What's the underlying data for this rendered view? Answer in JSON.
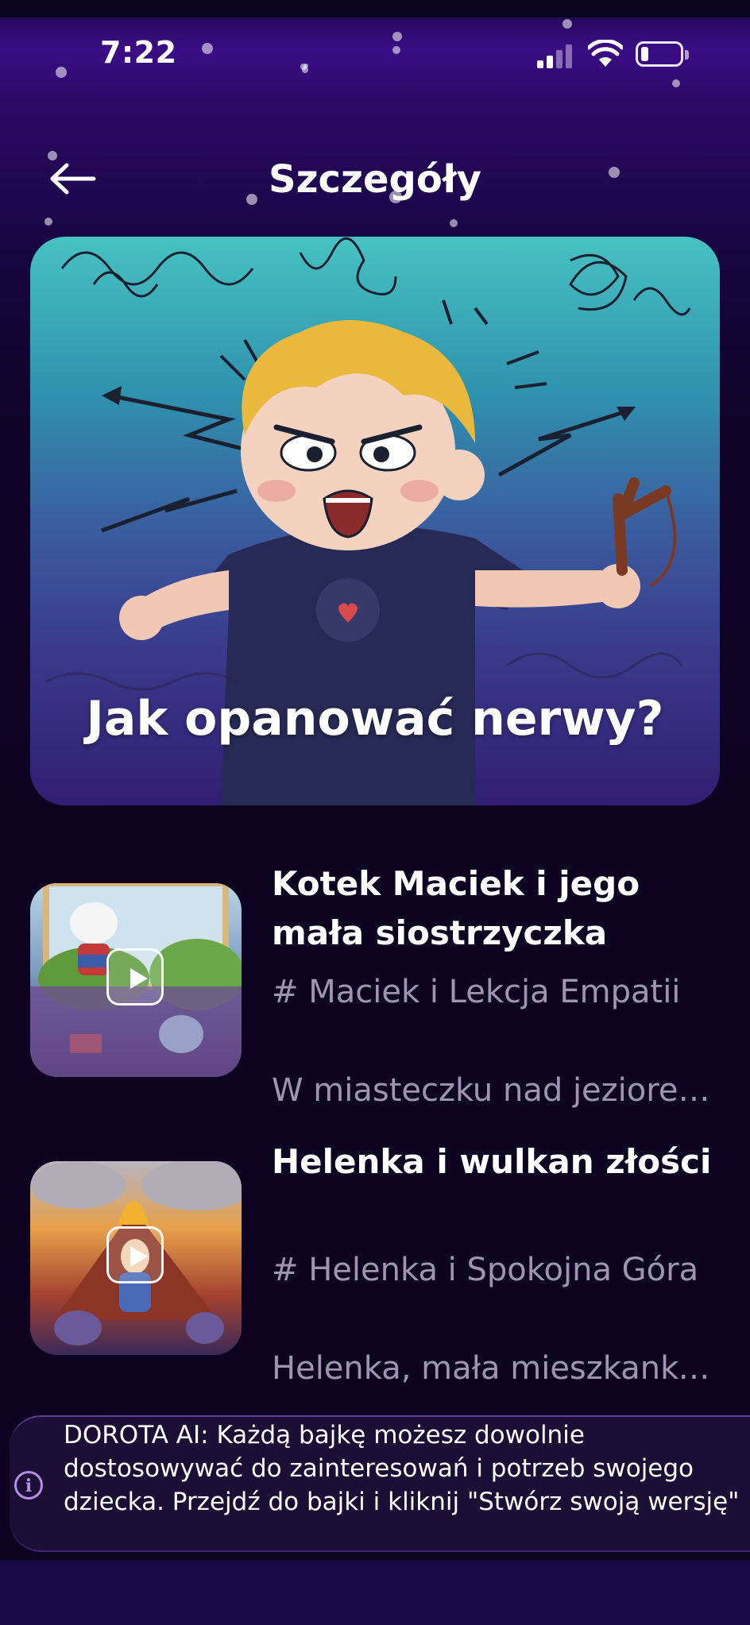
{
  "status_bar": {
    "time": "7:22",
    "battery_level": 0.2
  },
  "header": {
    "title": "Szczegóły"
  },
  "hero": {
    "title": "Jak opanować nerwy?"
  },
  "stories": [
    {
      "title": "Kotek Maciek i jego mała siostrzyczka",
      "tag": "# Maciek i Lekcja Empatii",
      "description": "W miasteczku nad jeziorem..."
    },
    {
      "title": "Helenka i wulkan złości",
      "tag": "# Helenka i Spokojna Góra",
      "description": "Helenka, mała mieszkanka..."
    }
  ],
  "info_banner": {
    "text": "DOROTA AI: Każdą bajkę możesz dowolnie dostosowywać do zainteresowań i potrzeb swojego dziecka. Przejdź do bajki i kliknij \"Stwórz swoją wersję\""
  },
  "colors": {
    "background": "#0d0421",
    "accent": "#b58ee8",
    "header_purple": "#3b0d86"
  }
}
